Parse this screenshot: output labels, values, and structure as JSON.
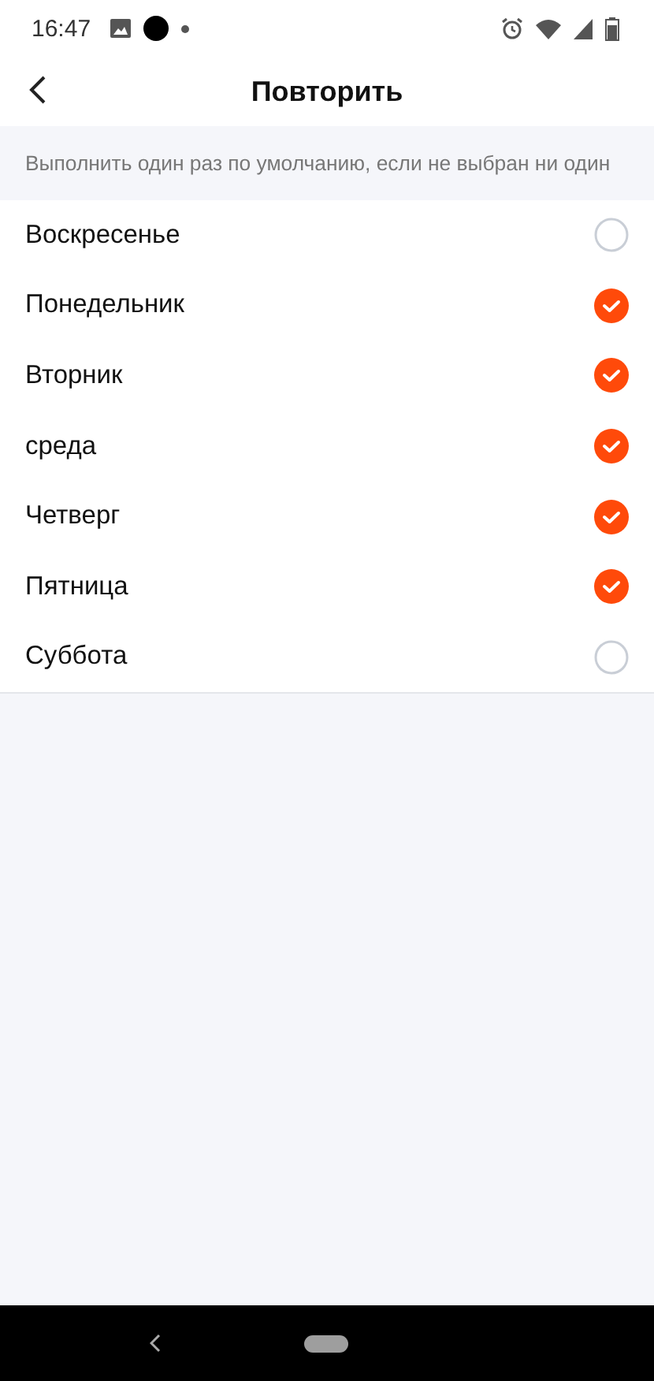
{
  "status_bar": {
    "time": "16:47"
  },
  "header": {
    "title": "Повторить"
  },
  "hint": "Выполнить один раз по умолчанию, если не выбран ни один",
  "days": [
    {
      "label": "Воскресенье",
      "checked": false
    },
    {
      "label": "Понедельник",
      "checked": true
    },
    {
      "label": "Вторник",
      "checked": true
    },
    {
      "label": "среда",
      "checked": true
    },
    {
      "label": "Четверг",
      "checked": true
    },
    {
      "label": "Пятница",
      "checked": true
    },
    {
      "label": "Суббота",
      "checked": false
    }
  ]
}
